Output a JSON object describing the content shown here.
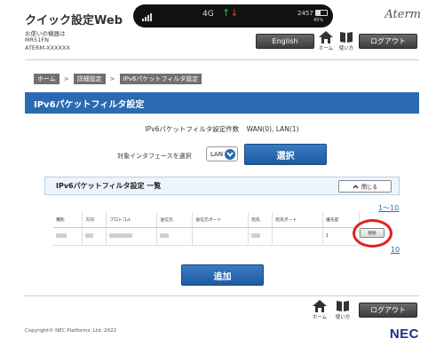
{
  "header": {
    "app_title": "クイック設定Web",
    "device_label": "お使いの機器は",
    "device_model": "MR51FN",
    "device_id": "ATERM-XXXXXX",
    "logo_text": "Aterm",
    "status": {
      "network": "4G",
      "time": "2457",
      "battery_pct": "45%",
      "battery_level": 0.45
    },
    "english_label": "English",
    "home_label": "ホーム",
    "help_label": "使い方",
    "logout_label": "ログアウト"
  },
  "breadcrumb": {
    "items": [
      "ホーム",
      "詳細設定",
      "IPv6パケットフィルタ設定"
    ],
    "separator": ">"
  },
  "section": {
    "title": "IPv6パケットフィルタ設定",
    "count_label": "IPv6パケットフィルタ設定件数",
    "count_value": "WAN(0), LAN(1)",
    "interface_label": "対象インタフェースを選択",
    "interface_value": "LAN",
    "select_button": "選択"
  },
  "list": {
    "title": "IPv6パケットフィルタ設定 一覧",
    "close_label": "閉じる",
    "pager_top": "1～10",
    "pager_bottom": "10",
    "columns": [
      "種別",
      "方向",
      "プロトコル",
      "送信元",
      "送信元ポート",
      "宛先",
      "宛先ポート",
      "優先度",
      ""
    ],
    "rows": [
      {
        "priority": "1",
        "delete_label": "削除"
      }
    ],
    "add_button": "追加"
  },
  "footer": {
    "home_label": "ホーム",
    "help_label": "使い方",
    "logout_label": "ログアウト",
    "copyright": "Copyright© NEC Platforms, Ltd. 2022",
    "brand": "NEC"
  },
  "colors": {
    "accent_blue": "#2a6ab1",
    "highlight_red": "#e02020",
    "dark_button": "#4a4a4a",
    "nec_blue": "#1a2f8c"
  }
}
